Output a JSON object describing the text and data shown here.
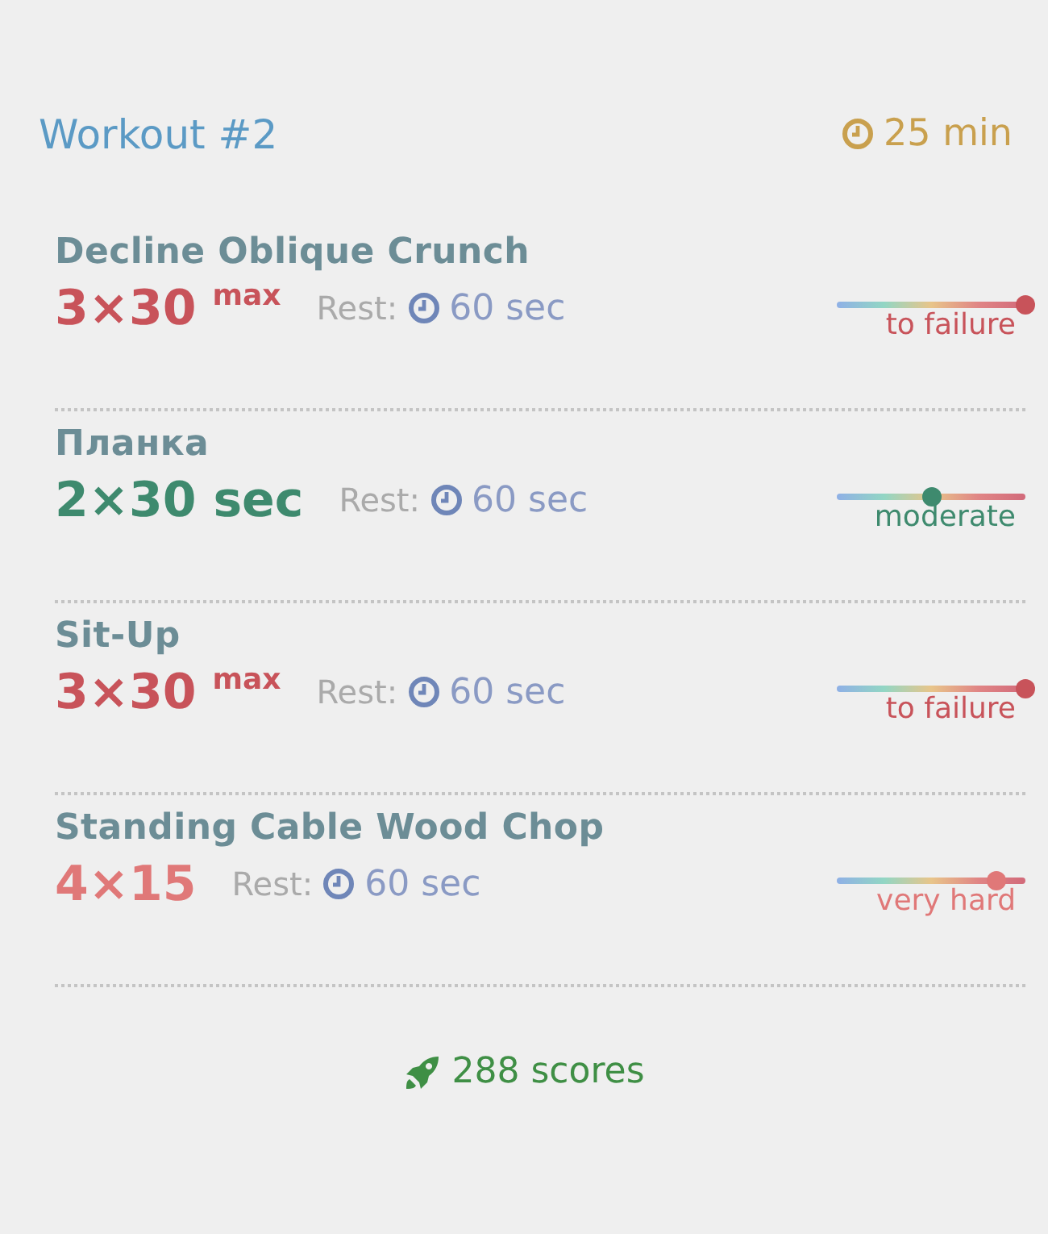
{
  "header": {
    "title": "Workout #2",
    "duration": "25 min"
  },
  "exercises": [
    {
      "name": "Decline Oblique Crunch",
      "sets": "3×30",
      "suffix": "max",
      "rest_label": "Rest:",
      "rest": "60 sec",
      "intensity": "to failure",
      "level": 1.0,
      "color": "#c8535a"
    },
    {
      "name": "Планка",
      "sets": "2×30 sec",
      "rest_label": "Rest:",
      "rest": "60 sec",
      "intensity": "moderate",
      "level": 0.5,
      "color": "#3e8a6e"
    },
    {
      "name": "Sit-Up",
      "sets": "3×30",
      "suffix": "max",
      "rest_label": "Rest:",
      "rest": "60 sec",
      "intensity": "to failure",
      "level": 1.0,
      "color": "#c8535a"
    },
    {
      "name": "Standing Cable Wood Chop",
      "sets": "4×15",
      "rest_label": "Rest:",
      "rest": "60 sec",
      "intensity": "very hard",
      "level": 0.85,
      "color": "#e07878"
    }
  ],
  "footer": {
    "scores": "288 scores"
  }
}
